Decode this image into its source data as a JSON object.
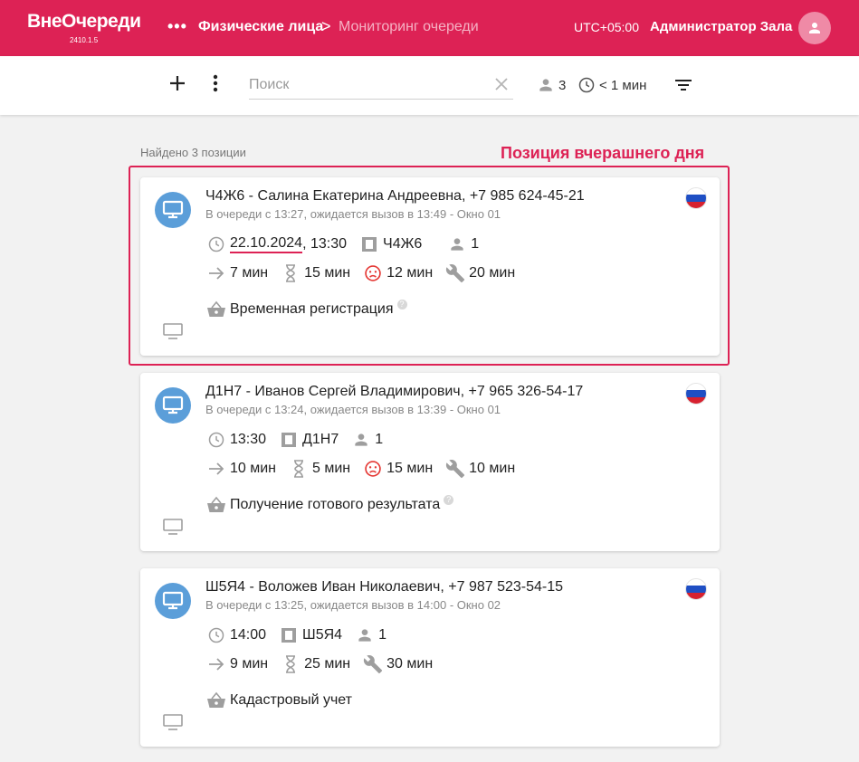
{
  "header": {
    "brand": "ВнеОчереди",
    "version": "2410.1.5",
    "more": "•••",
    "breadcrumb_primary": "Физические лица",
    "breadcrumb_separator": ">",
    "breadcrumb_current": "Мониторинг очереди",
    "timezone": "UTC+05:00",
    "user_name": "Администратор Зала"
  },
  "toolbar": {
    "search_placeholder": "Поиск",
    "people_count": "3",
    "wait_time": "< 1 мин"
  },
  "results": {
    "found_text": "Найдено 3 позиции",
    "annotation": "Позиция вчерашнего дня"
  },
  "cards": [
    {
      "title": "Ч4Ж6 - Салина Екатерина Андреевна, +7 985 624-45-21",
      "subtitle": "В очереди с 13:27, ожидается вызов в 13:49 - Окно 01",
      "date": "22.10.2024",
      "date_suffix": ",",
      "time": "13:30",
      "ticket": "Ч4Ж6",
      "persons": "1",
      "route_time": "7 мин",
      "wait_time": "15 мин",
      "late_time": "12 мин",
      "service_time": "20 мин",
      "service": "Временная регистрация",
      "help_mark": "?"
    },
    {
      "title": "Д1Н7 - Иванов Сергей Владимирович, +7 965 326-54-17",
      "subtitle": "В очереди с 13:24, ожидается вызов в 13:39 - Окно 01",
      "time": "13:30",
      "ticket": "Д1Н7",
      "persons": "1",
      "route_time": "10 мин",
      "wait_time": "5 мин",
      "late_time": "15 мин",
      "service_time": "10 мин",
      "service": "Получение готового результата",
      "help_mark": "?"
    },
    {
      "title": "Ш5Я4 - Воложев Иван Николаевич, +7 987 523-54-15",
      "subtitle": "В очереди с 13:25, ожидается вызов в 14:00 - Окно 02",
      "time": "14:00",
      "ticket": "Ш5Я4",
      "persons": "1",
      "route_time": "9 мин",
      "wait_time": "25 мин",
      "service_time": "30 мин",
      "service": "Кадастровый учет"
    }
  ],
  "colors": {
    "brand": "#dd2255",
    "avatar_blue": "#5b9ed9",
    "late_red": "#e53935",
    "icon_grey": "#9e9e9e"
  },
  "icons": {
    "add": "plus-icon",
    "more": "more-vert-icon",
    "clear": "close-icon",
    "people": "person-icon",
    "clock": "clock-icon",
    "filter": "filter-icon",
    "monitor": "monitor-icon",
    "ticket": "ticket-icon",
    "route": "arrow-right-icon",
    "wait": "hourglass-icon",
    "late": "sad-face-icon",
    "service": "wrench-icon",
    "basket": "basket-icon",
    "flag": "russia-flag-icon"
  }
}
